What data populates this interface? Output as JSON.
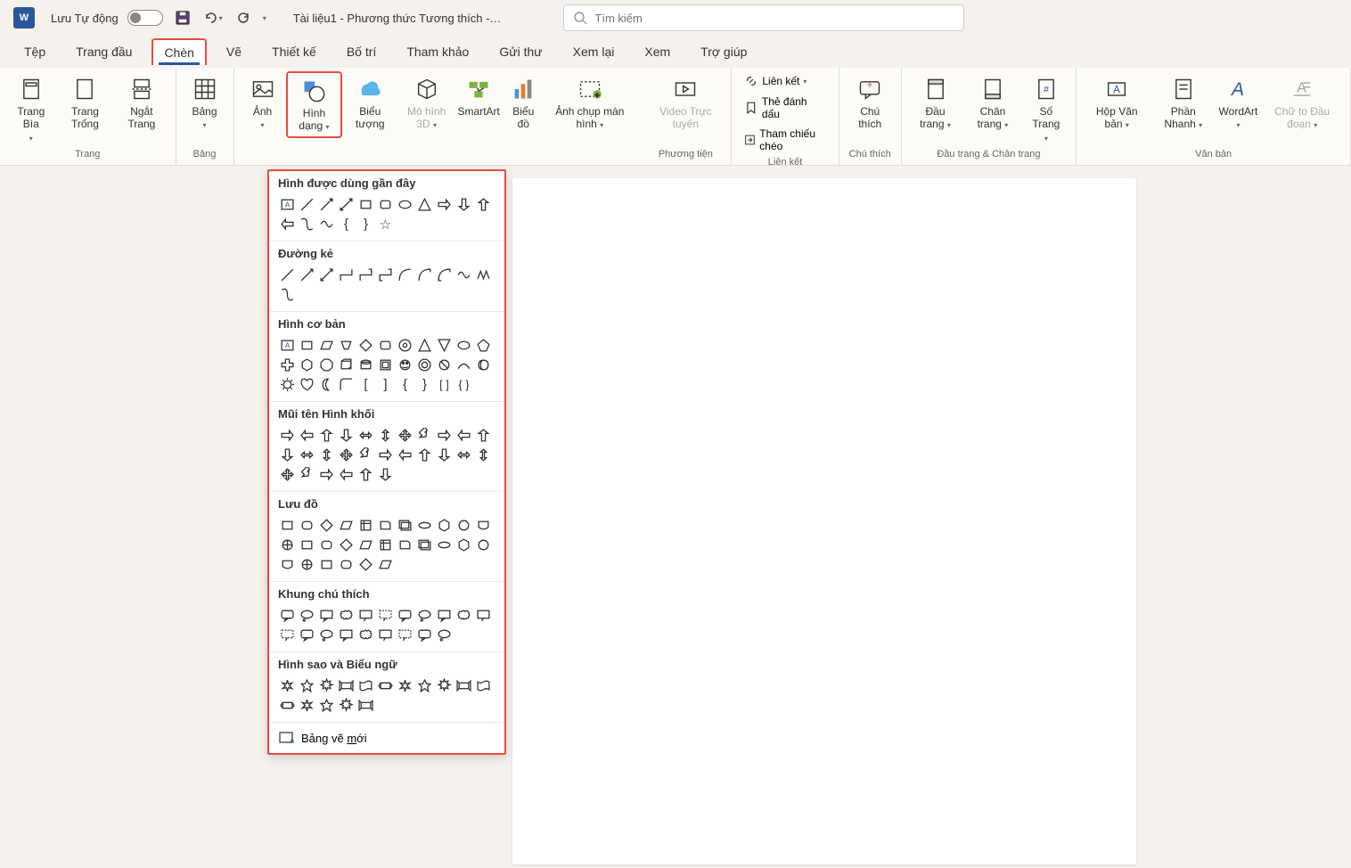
{
  "titlebar": {
    "autosave": "Lưu Tự động",
    "doc_title": "Tài liệu1 - Phương thức Tương thích -…"
  },
  "search": {
    "placeholder": "Tìm kiếm"
  },
  "tabs": {
    "file": "Tệp",
    "home": "Trang đầu",
    "insert": "Chèn",
    "draw": "Vẽ",
    "design": "Thiết kế",
    "layout": "Bố trí",
    "references": "Tham khảo",
    "mailings": "Gửi thư",
    "review": "Xem lại",
    "view": "Xem",
    "help": "Trợ giúp"
  },
  "ribbon": {
    "pages": {
      "label": "Trang",
      "cover": "Trang Bìa",
      "blank": "Trang Trống",
      "break": "Ngắt Trang"
    },
    "tables": {
      "label": "Bảng",
      "table": "Bảng"
    },
    "illustrations": {
      "pictures": "Ảnh",
      "shapes": "Hình dạng",
      "icons": "Biểu tượng",
      "models3d": "Mô hình 3D",
      "smartart": "SmartArt",
      "chart": "Biểu đồ",
      "screenshot": "Ảnh chụp màn hình"
    },
    "media": {
      "label": "Phương tiện",
      "video": "Video Trực tuyến"
    },
    "links": {
      "label": "Liên kết",
      "link": "Liên kết",
      "bookmark": "Thẻ đánh dấu",
      "crossref": "Tham chiếu chéo"
    },
    "comments": {
      "label": "Chú thích",
      "comment": "Chú thích"
    },
    "headerfooter": {
      "label": "Đầu trang & Chân trang",
      "header": "Đầu trang",
      "footer": "Chân trang",
      "pagenum": "Số Trang"
    },
    "text": {
      "label": "Văn bản",
      "textbox": "Hộp Văn bản",
      "quickparts": "Phần Nhanh",
      "wordart": "WordArt",
      "dropcap": "Chữ to Đầu đoạn"
    }
  },
  "shapes_menu": {
    "recent": "Hình được dùng gần đây",
    "lines": "Đường kẻ",
    "basic": "Hình cơ bản",
    "arrows": "Mũi tên Hình khối",
    "flowchart": "Lưu đồ",
    "callouts": "Khung chú thích",
    "stars": "Hình sao và Biểu ngữ",
    "new_canvas": "Bảng vẽ ",
    "new_canvas_u": "m",
    "new_canvas_end": "ới"
  }
}
